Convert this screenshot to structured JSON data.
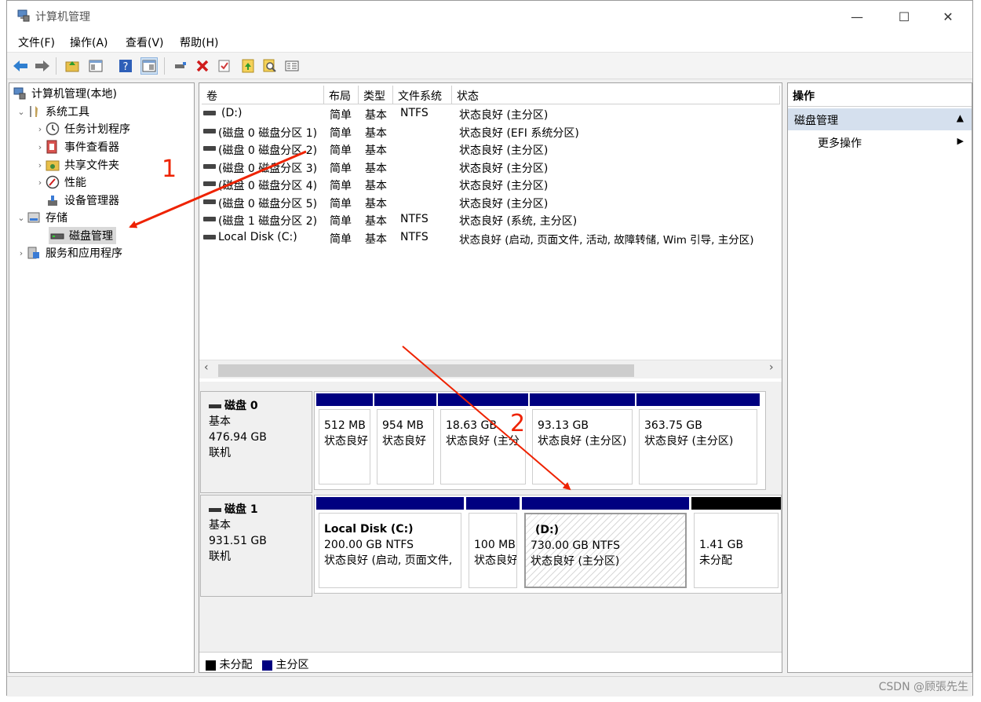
{
  "window": {
    "title": "计算机管理",
    "controls": {
      "minimize": "—",
      "maximize": "☐",
      "close": "✕"
    }
  },
  "menu": [
    "文件(F)",
    "操作(A)",
    "查看(V)",
    "帮助(H)"
  ],
  "toolbar_icons": [
    "back-arrow-icon",
    "forward-arrow-icon",
    "up-folder-icon",
    "show-hide-tree-icon",
    "help-icon",
    "properties-view-icon",
    "connect-icon",
    "delete-icon",
    "check-icon",
    "import-icon",
    "search-icon",
    "properties-icon"
  ],
  "tree": {
    "root": "计算机管理(本地)",
    "items": [
      {
        "label": "系统工具",
        "level": 1,
        "chevron": "⌄"
      },
      {
        "label": "任务计划程序",
        "level": 2,
        "chevron": "›"
      },
      {
        "label": "事件查看器",
        "level": 2,
        "chevron": "›"
      },
      {
        "label": "共享文件夹",
        "level": 2,
        "chevron": "›"
      },
      {
        "label": "性能",
        "level": 2,
        "chevron": "›"
      },
      {
        "label": "设备管理器",
        "level": 2,
        "chevron": ""
      },
      {
        "label": "存储",
        "level": 1,
        "chevron": "⌄"
      },
      {
        "label": "磁盘管理",
        "level": 2,
        "chevron": "",
        "selected": true
      },
      {
        "label": "服务和应用程序",
        "level": 1,
        "chevron": "›"
      }
    ]
  },
  "volume_list": {
    "columns": [
      "卷",
      "布局",
      "类型",
      "文件系统",
      "状态"
    ],
    "rows": [
      {
        "vol": "(D:)",
        "layout": "简单",
        "type": "基本",
        "fs": "NTFS",
        "status": "状态良好 (主分区)"
      },
      {
        "vol": "(磁盘 0 磁盘分区 1)",
        "layout": "简单",
        "type": "基本",
        "fs": "",
        "status": "状态良好 (EFI 系统分区)"
      },
      {
        "vol": "(磁盘 0 磁盘分区 2)",
        "layout": "简单",
        "type": "基本",
        "fs": "",
        "status": "状态良好 (主分区)"
      },
      {
        "vol": "(磁盘 0 磁盘分区 3)",
        "layout": "简单",
        "type": "基本",
        "fs": "",
        "status": "状态良好 (主分区)"
      },
      {
        "vol": "(磁盘 0 磁盘分区 4)",
        "layout": "简单",
        "type": "基本",
        "fs": "",
        "status": "状态良好 (主分区)"
      },
      {
        "vol": "(磁盘 0 磁盘分区 5)",
        "layout": "简单",
        "type": "基本",
        "fs": "",
        "status": "状态良好 (主分区)"
      },
      {
        "vol": "(磁盘 1 磁盘分区 2)",
        "layout": "简单",
        "type": "基本",
        "fs": "NTFS",
        "status": "状态良好 (系统, 主分区)"
      },
      {
        "vol": "Local Disk (C:)",
        "layout": "简单",
        "type": "基本",
        "fs": "NTFS",
        "status": "状态良好 (启动, 页面文件, 活动, 故障转储, Wim 引导, 主分区)"
      }
    ],
    "scroll_left": "‹",
    "scroll_right": "›"
  },
  "disks": [
    {
      "name": "磁盘 0",
      "type": "基本",
      "size": "476.94 GB",
      "state": "联机",
      "partitions": [
        {
          "title": "",
          "line1": "512 MB",
          "line2": "状态良好"
        },
        {
          "title": "",
          "line1": "954 MB",
          "line2": "状态良好"
        },
        {
          "title": "",
          "line1": "18.63 GB",
          "line2": "状态良好 (主分"
        },
        {
          "title": "",
          "line1": "93.13 GB",
          "line2": "状态良好 (主分区)"
        },
        {
          "title": "",
          "line1": "363.75 GB",
          "line2": "状态良好 (主分区)"
        }
      ]
    },
    {
      "name": "磁盘 1",
      "type": "基本",
      "size": "931.51 GB",
      "state": "联机",
      "partitions": [
        {
          "title": "Local Disk  (C:)",
          "line1": "200.00 GB NTFS",
          "line2": "状态良好 (启动, 页面文件,"
        },
        {
          "title": "",
          "line1": "100 MB",
          "line2": "状态良好"
        },
        {
          "title": "(D:)",
          "line1": "730.00 GB NTFS",
          "line2": "状态良好 (主分区)"
        },
        {
          "title": "",
          "line1": "1.41 GB",
          "line2": "未分配"
        }
      ]
    }
  ],
  "legend": [
    {
      "label": "未分配",
      "color": "#000000"
    },
    {
      "label": "主分区",
      "color": "#000080"
    }
  ],
  "actions": {
    "header": "操作",
    "group": "磁盘管理",
    "group_arrow": "▲",
    "item": "更多操作",
    "item_arrow": "▶"
  },
  "annotations": [
    "1",
    "2"
  ],
  "watermark": "CSDN @顾張先生",
  "colors": {
    "primary_partition": "#000080",
    "unallocated": "#000000",
    "annotation": "#ee2200",
    "selected_group": "#d5e0ee"
  }
}
